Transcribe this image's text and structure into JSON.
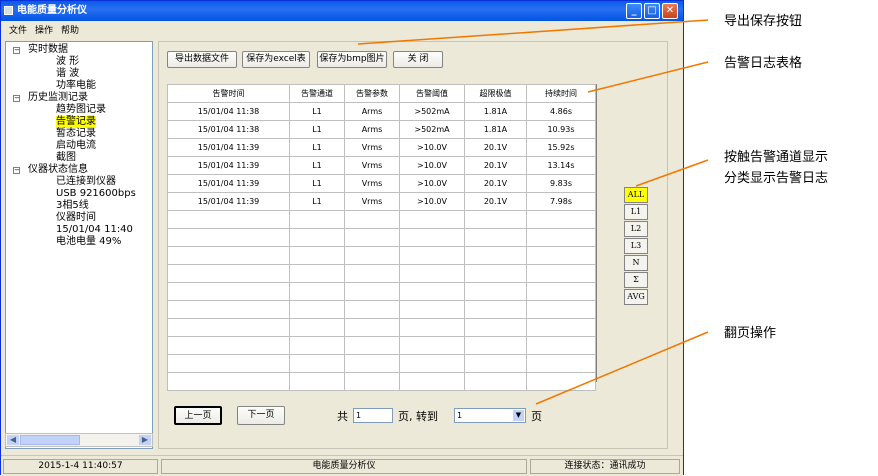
{
  "window": {
    "title": "电能质量分析仪"
  },
  "menu": [
    "文件",
    "操作",
    "帮助"
  ],
  "tree": {
    "realtime": {
      "label": "实时数据",
      "children": [
        "波 形",
        "谐 波",
        "功率电能"
      ]
    },
    "history": {
      "label": "历史监测记录",
      "children": [
        "趋势图记录",
        "告警记录",
        "暂态记录",
        "启动电流",
        "截图"
      ]
    },
    "status": {
      "label": "仪器状态信息",
      "children": [
        "已连接到仪器",
        "USB 921600bps",
        "3相5线",
        "仪器时间",
        "15/01/04 11:40",
        "电池电量 49%"
      ]
    }
  },
  "toolbar": {
    "export_file": "导出数据文件",
    "save_excel": "保存为excel表",
    "save_bmp": "保存为bmp图片",
    "close": "关 闭"
  },
  "table": {
    "headers": [
      "告警时间",
      "告警通道",
      "告警参数",
      "告警阈值",
      "超限极值",
      "持续时间"
    ],
    "rows": [
      [
        "15/01/04 11:38",
        "L1",
        "Arms",
        ">502mA",
        "1.81A",
        "4.86s"
      ],
      [
        "15/01/04 11:38",
        "L1",
        "Arms",
        ">502mA",
        "1.81A",
        "10.93s"
      ],
      [
        "15/01/04 11:39",
        "L1",
        "Vrms",
        ">10.0V",
        "20.1V",
        "15.92s"
      ],
      [
        "15/01/04 11:39",
        "L1",
        "Vrms",
        ">10.0V",
        "20.1V",
        "13.14s"
      ],
      [
        "15/01/04 11:39",
        "L1",
        "Vrms",
        ">10.0V",
        "20.1V",
        "9.83s"
      ],
      [
        "15/01/04 11:39",
        "L1",
        "Vrms",
        ">10.0V",
        "20.1V",
        "7.98s"
      ]
    ]
  },
  "channels": [
    "ALL",
    "L1",
    "L2",
    "L3",
    "N",
    "Σ",
    "AVG"
  ],
  "pager": {
    "prev": "上一页",
    "next": "下一页",
    "total_prefix": "共",
    "total_value": "1",
    "page_suffix": "页, 转到",
    "goto_value": "1",
    "page_unit": "页"
  },
  "statusbar": {
    "datetime": "2015-1-4 11:40:57",
    "app": "电能质量分析仪",
    "connection": "连接状态：通讯成功"
  },
  "callouts": {
    "export": "导出保存按钮",
    "table": "告警日志表格",
    "channel_line1": "按触告警通道显示",
    "channel_line2": "分类显示告警日志",
    "paging": "翻页操作"
  },
  "colors": {
    "titlebar": "#0054e3",
    "highlight": "#ffff00",
    "callout_line": "#f07800"
  }
}
